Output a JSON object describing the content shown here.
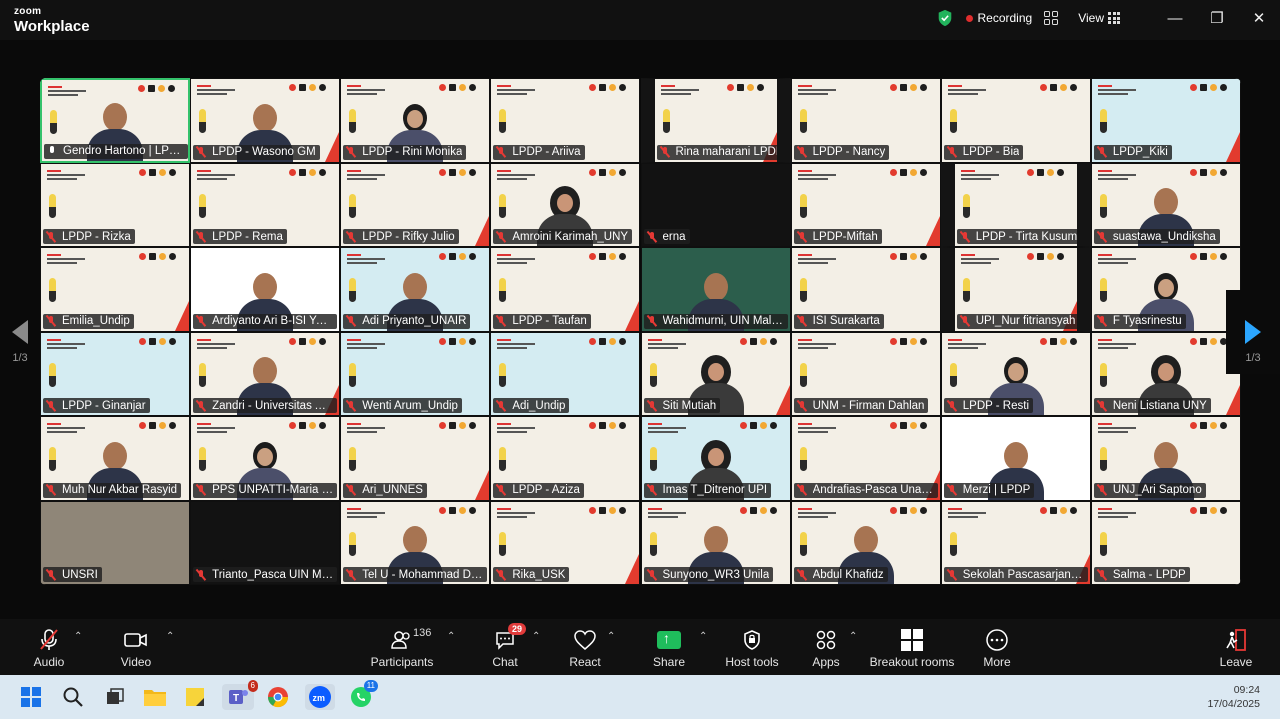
{
  "titlebar": {
    "brand_top": "zoom",
    "brand_bottom": "Workplace",
    "recording_label": "Recording",
    "view_label": "View",
    "minimize": "—",
    "restore": "❐",
    "close": "✕"
  },
  "pager": {
    "left_label": "1/3",
    "right_label": "1/3"
  },
  "participants": [
    {
      "name": "Gendro Hartono | LPDP",
      "bg": "slide",
      "person": "man",
      "muted": false,
      "active": true
    },
    {
      "name": "LPDP - Wasono GM",
      "bg": "slide",
      "person": "man",
      "muted": true
    },
    {
      "name": "LPDP - Rini Monika",
      "bg": "slide",
      "person": "hair",
      "muted": true
    },
    {
      "name": "LPDP - Ariiva",
      "bg": "slide",
      "person": "none",
      "muted": true
    },
    {
      "name": "Rina maharani LPDP",
      "bg": "bars",
      "person": "none",
      "muted": true
    },
    {
      "name": "LPDP - Nancy",
      "bg": "slide",
      "person": "none",
      "muted": true
    },
    {
      "name": "LPDP - Bia",
      "bg": "slide",
      "person": "none",
      "muted": true
    },
    {
      "name": "LPDP_Kiki",
      "bg": "blue",
      "person": "none",
      "muted": true
    },
    {
      "name": "LPDP - Rizka",
      "bg": "slide",
      "person": "none",
      "muted": true
    },
    {
      "name": "LPDP - Rema",
      "bg": "slide",
      "person": "none",
      "muted": true
    },
    {
      "name": "LPDP - Rifky Julio",
      "bg": "slide",
      "person": "none",
      "muted": true
    },
    {
      "name": "Amroini Karimah_UNY",
      "bg": "slide",
      "person": "hijab",
      "muted": true
    },
    {
      "name": "erna",
      "bg": "dark",
      "person": "none",
      "muted": true
    },
    {
      "name": "LPDP-Miftah",
      "bg": "slide",
      "person": "none",
      "muted": true
    },
    {
      "name": "LPDP - Tirta Kusuma",
      "bg": "bars",
      "person": "none",
      "muted": true
    },
    {
      "name": "suastawa_Undiksha",
      "bg": "slide",
      "person": "man",
      "muted": true
    },
    {
      "name": "Emilia_Undip",
      "bg": "slide",
      "person": "none",
      "muted": true
    },
    {
      "name": "Ardiyanto Ari B-ISI Yogyakarta",
      "bg": "whiteslide",
      "person": "man",
      "muted": true
    },
    {
      "name": "Adi Priyanto_UNAIR",
      "bg": "blue",
      "person": "man",
      "muted": true
    },
    {
      "name": "LPDP - Taufan",
      "bg": "slide",
      "person": "none",
      "muted": true
    },
    {
      "name": "Wahidmurni, UIN Malang",
      "bg": "greenslide",
      "person": "man",
      "muted": true
    },
    {
      "name": "ISI Surakarta",
      "bg": "slide",
      "person": "none",
      "muted": true
    },
    {
      "name": "UPI_Nur fitriansyah",
      "bg": "bars",
      "person": "none",
      "muted": true
    },
    {
      "name": "F Tyasrinestu",
      "bg": "slide",
      "person": "hair",
      "muted": true
    },
    {
      "name": "LPDP - Ginanjar",
      "bg": "blue",
      "person": "none",
      "muted": true
    },
    {
      "name": "Zandri - Universitas Andalas",
      "bg": "slide",
      "person": "man",
      "muted": true
    },
    {
      "name": "Wenti Arum_Undip",
      "bg": "blue",
      "person": "none",
      "muted": true
    },
    {
      "name": "Adi_Undip",
      "bg": "blue",
      "person": "none",
      "muted": true
    },
    {
      "name": "Siti Mutiah",
      "bg": "slide",
      "person": "hijab",
      "muted": true
    },
    {
      "name": "UNM - Firman Dahlan",
      "bg": "slide",
      "person": "none",
      "muted": true
    },
    {
      "name": "LPDP - Resti",
      "bg": "slide",
      "person": "hair",
      "muted": true
    },
    {
      "name": "Neni Listiana UNY",
      "bg": "slide",
      "person": "hijab",
      "muted": true
    },
    {
      "name": "Muh Nur Akbar Rasyid",
      "bg": "slide",
      "person": "man",
      "muted": true
    },
    {
      "name": "PPS UNPATTI-Maria Nendissa",
      "bg": "slide",
      "person": "hair",
      "muted": true
    },
    {
      "name": "Ari_UNNES",
      "bg": "slide",
      "person": "none",
      "muted": true
    },
    {
      "name": "LPDP - Aziza",
      "bg": "slide",
      "person": "none",
      "muted": true
    },
    {
      "name": "Imas T_Ditrenor UPI",
      "bg": "blue",
      "person": "hijab",
      "muted": true
    },
    {
      "name": "Andrafias-Pasca Unand",
      "bg": "slide",
      "person": "none",
      "muted": true
    },
    {
      "name": "Merzi | LPDP",
      "bg": "whiteslide",
      "person": "man",
      "muted": true
    },
    {
      "name": "UNJ_Ari Saptono",
      "bg": "slide",
      "person": "man",
      "muted": true
    },
    {
      "name": "UNSRI",
      "bg": "room",
      "person": "none",
      "muted": true
    },
    {
      "name": "Trianto_Pasca UIN Malang",
      "bg": "dark",
      "person": "none",
      "muted": true
    },
    {
      "name": "Tel U - Mohammad Dinda",
      "bg": "slide",
      "person": "man",
      "muted": true
    },
    {
      "name": "Rika_USK",
      "bg": "slide",
      "person": "none",
      "muted": true
    },
    {
      "name": "Sunyono_WR3 Unila",
      "bg": "slide",
      "person": "man",
      "muted": true
    },
    {
      "name": "Abdul Khafidz",
      "bg": "slide",
      "person": "man",
      "muted": true
    },
    {
      "name": "Sekolah Pascasarjana UNS",
      "bg": "slide",
      "person": "none",
      "muted": true
    },
    {
      "name": "Salma - LPDP",
      "bg": "slide",
      "person": "none",
      "muted": true
    }
  ],
  "toolbar": {
    "audio": "Audio",
    "video": "Video",
    "participants": "Participants",
    "participants_count": "136",
    "chat": "Chat",
    "chat_badge": "29",
    "react": "React",
    "share": "Share",
    "host_tools": "Host tools",
    "apps": "Apps",
    "breakout": "Breakout rooms",
    "more": "More",
    "leave": "Leave"
  },
  "taskbar": {
    "teams_badge": "6",
    "whatsapp_badge": "11",
    "time": "09:24",
    "date": "17/04/2025"
  },
  "colors": {
    "accent_green": "#34c26b",
    "recording_red": "#e02d2d",
    "share_green": "#1fbd5c",
    "pager_blue": "#2ba6ff"
  }
}
